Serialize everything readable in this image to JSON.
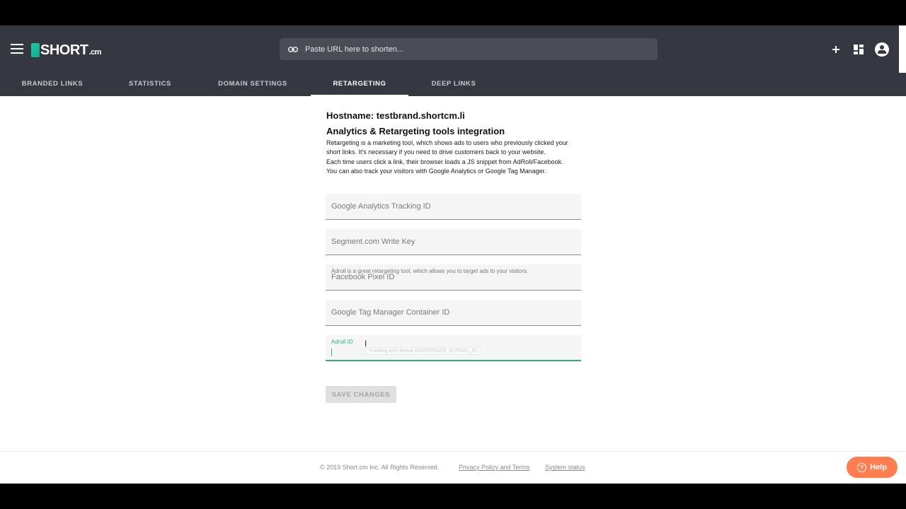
{
  "header": {
    "logo_text": "SHORT",
    "logo_tld": ".cm",
    "search_placeholder": "Paste URL here to shorten..."
  },
  "tabs": [
    {
      "label": "BRANDED LINKS"
    },
    {
      "label": "STATISTICS"
    },
    {
      "label": "DOMAIN SETTINGS"
    },
    {
      "label": "RETARGETING",
      "active": true
    },
    {
      "label": "DEEP LINKS"
    }
  ],
  "main": {
    "hostname": "Hostname: testbrand.shortcm.li",
    "title": "Analytics & Retargeting tools integration",
    "desc_1": "Retargeting is a marketing tool, which shows ads to users who previously clicked your short links. It's necessary if you need to drive customers back to your website.",
    "desc_2": "Each time users click a link, their browser loads a JS snippet from AdRoll/Facebook.",
    "desc_3": "You can also track your visitors with Google Analytics or Google Tag Manager.",
    "fields": {
      "ga": "Google Analytics Tracking ID",
      "segment": "Segment.com Write Key",
      "facebook": "Facebook Pixel ID",
      "gtm": "Google Tag Manager Container ID",
      "adroll_label": "Adroll ID",
      "adroll_tooltip": "Tracking id in format ADVERTISER_ID:PIXEL_ID",
      "adroll_hint": "Adroll is a great retargeting tool, which allows you to target ads to your visitors."
    },
    "save_label": "SAVE CHANGES"
  },
  "footer": {
    "copyright": "© 2019  Short.cm Inc. All Rights Reserved.",
    "privacy": "Privacy Policy and Terms",
    "status": "System status",
    "help": "Help"
  },
  "colors": {
    "header_bg": "#353840",
    "accent_green": "#2db08a",
    "help_orange": "#ff7d4e"
  }
}
